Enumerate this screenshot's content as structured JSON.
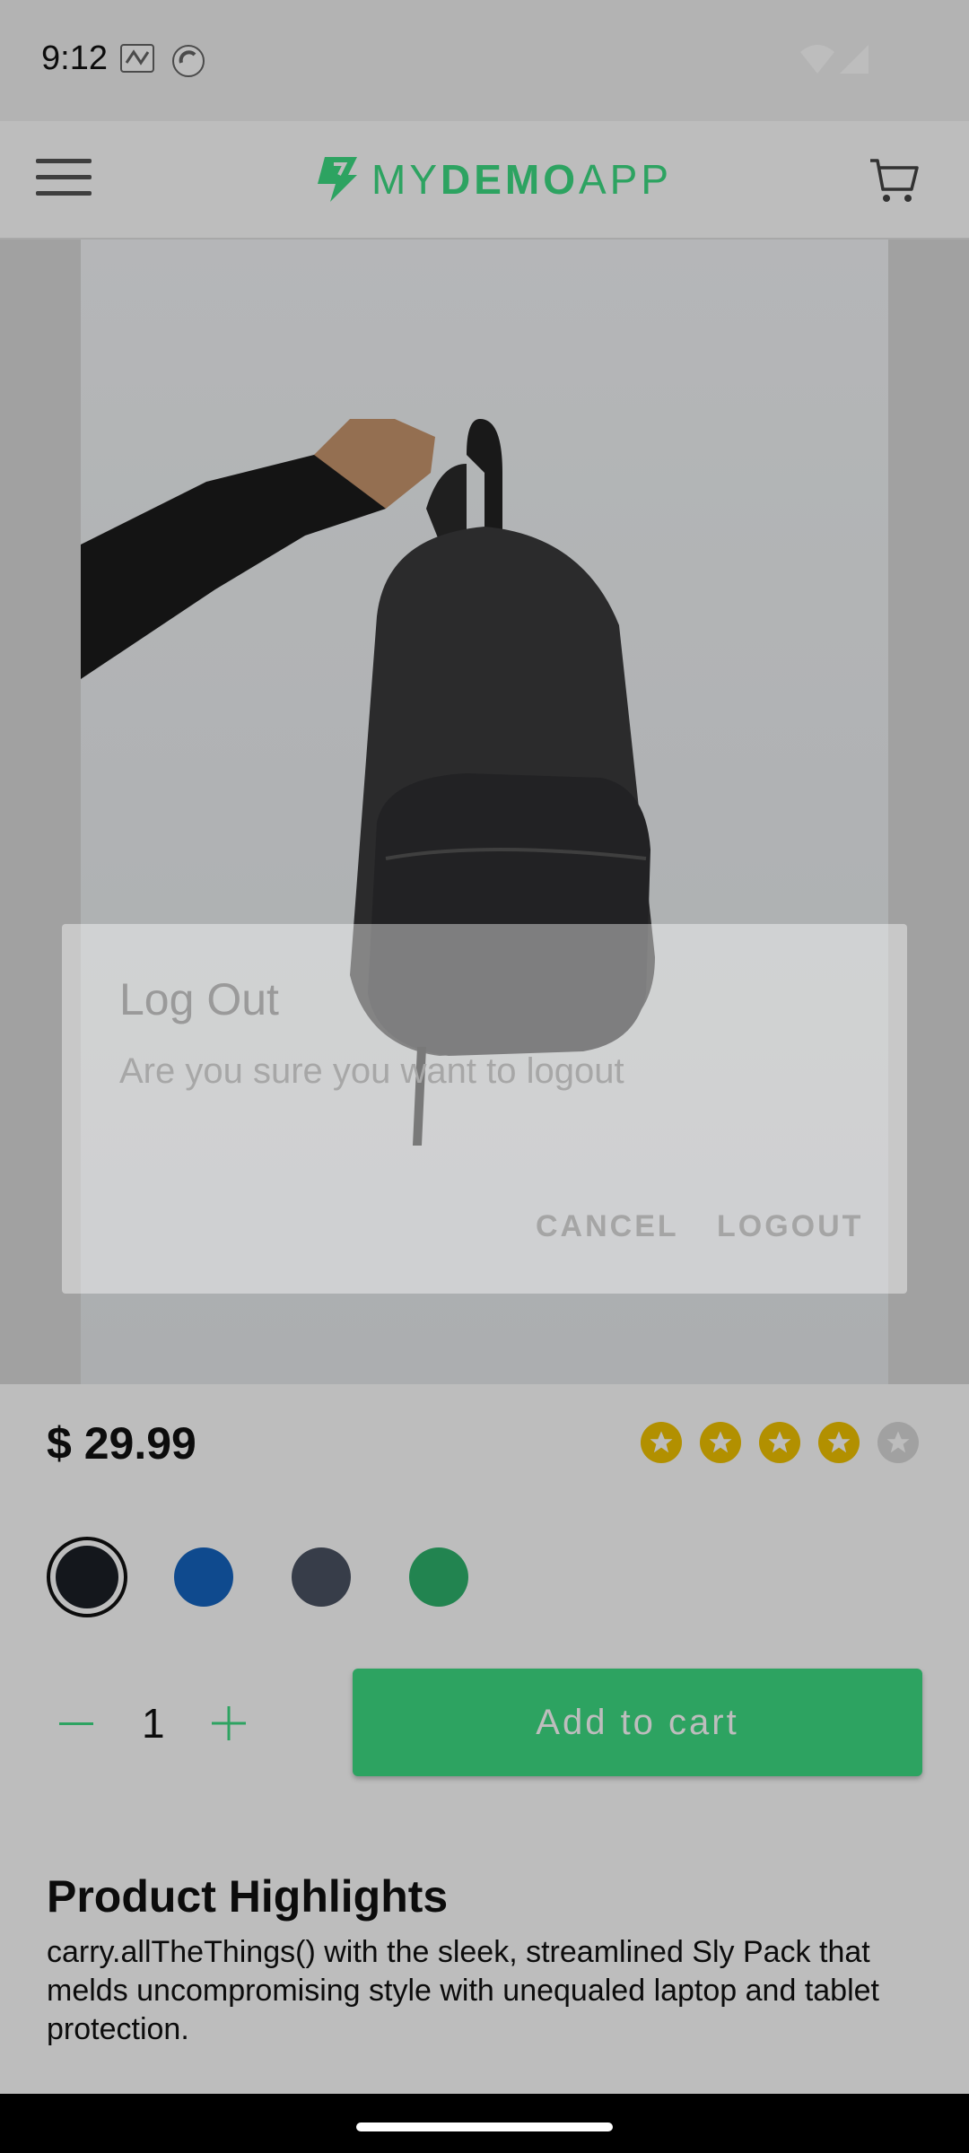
{
  "status": {
    "time": "9:12"
  },
  "header": {
    "logo_my": "MY",
    "logo_demo": "DEMO",
    "logo_app": "APP"
  },
  "product": {
    "price": "$ 29.99",
    "rating": {
      "value": 4,
      "max": 5
    },
    "colors": [
      "#1b1f27",
      "#1565c0",
      "#4b5363",
      "#2fb36d"
    ],
    "selected_color_index": 0,
    "quantity": "1",
    "add_to_cart_label": "Add to cart",
    "highlights_title": "Product Highlights",
    "highlights_body": "carry.allTheThings() with the sleek, streamlined Sly Pack that melds uncompromising style with unequaled laptop and tablet protection."
  },
  "dialog": {
    "title": "Log Out",
    "message": "Are you sure you want to logout",
    "cancel_label": "CANCEL",
    "logout_label": "LOGOUT"
  },
  "theme": {
    "accent": "#3ddc84"
  }
}
